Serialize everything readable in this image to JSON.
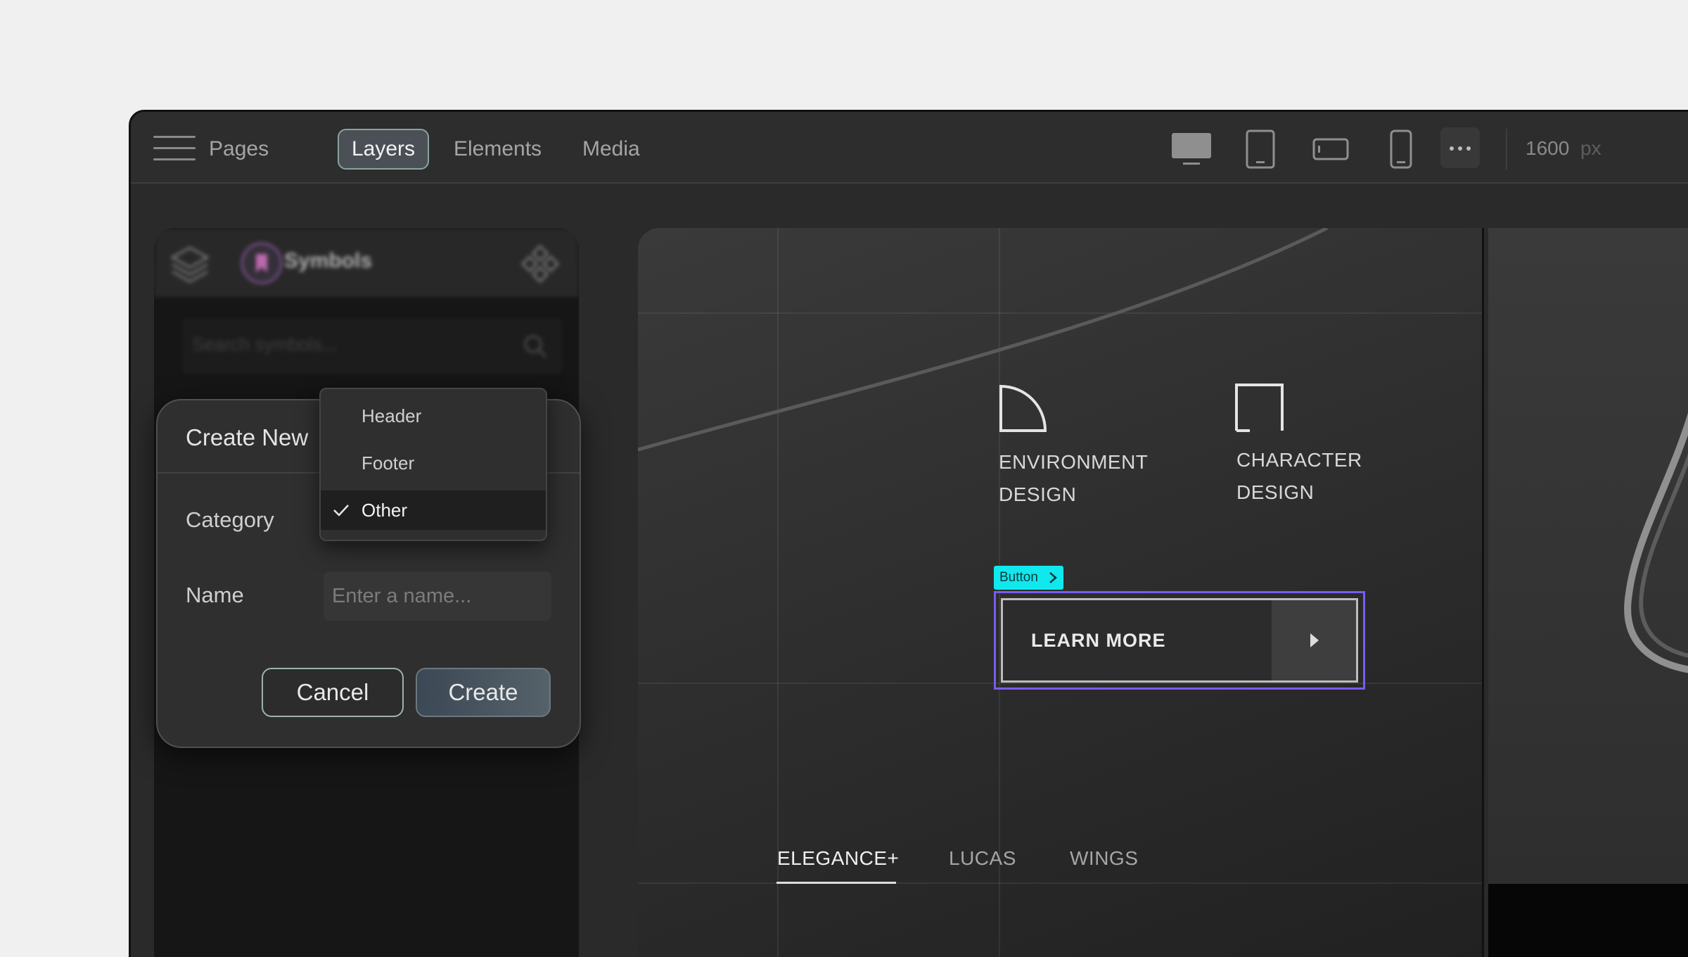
{
  "topbar": {
    "tabs": [
      {
        "label": "Pages",
        "active": false
      },
      {
        "label": "Layers",
        "active": true
      },
      {
        "label": "Elements",
        "active": false
      },
      {
        "label": "Media",
        "active": false
      }
    ],
    "devices": [
      {
        "icon": "desktop-icon",
        "active": true
      },
      {
        "icon": "tablet-portrait-icon",
        "active": false
      },
      {
        "icon": "tablet-landscape-icon",
        "active": false
      },
      {
        "icon": "mobile-icon",
        "active": false
      }
    ],
    "canvas_width_value": "1600",
    "canvas_width_unit": "px"
  },
  "left_panel": {
    "title": "Symbols",
    "search_placeholder": "Search symbols..."
  },
  "create_dialog": {
    "title": "Create New",
    "category_label": "Category",
    "name_label": "Name",
    "name_placeholder": "Enter a name...",
    "name_value": "",
    "cancel_label": "Cancel",
    "create_label": "Create"
  },
  "category_dropdown": {
    "options": [
      "Header",
      "Footer",
      "Other"
    ],
    "selected": "Other"
  },
  "canvas": {
    "cards": [
      {
        "line1": "ENVIRONMENT",
        "line2": "DESIGN",
        "icon": "quarter-circle-icon"
      },
      {
        "line1": "CHARACTER",
        "line2": "DESIGN",
        "icon": "square-outline-icon"
      }
    ],
    "selection_tag": "Button",
    "button_label": "LEARN MORE",
    "bottom_tabs": [
      {
        "label": "ELEGANCE+",
        "active": true
      },
      {
        "label": "LUCAS",
        "active": false
      },
      {
        "label": "WINGS",
        "active": false
      }
    ]
  },
  "colors": {
    "selection_outline": "#7a5cf0",
    "selection_tag": "#10e8ee",
    "active_tab_border": "#8aa3a0"
  }
}
